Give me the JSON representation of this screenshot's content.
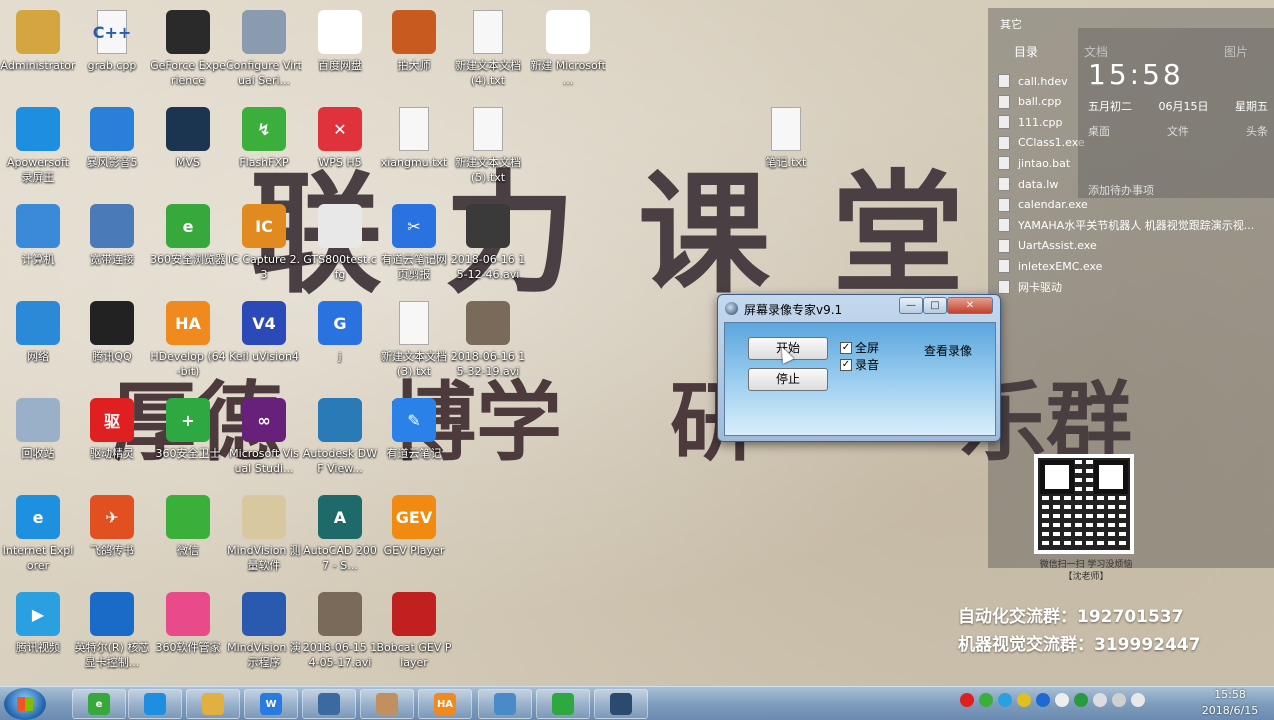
{
  "wallpaper": {
    "line1": "联力课堂",
    "line2": [
      "厚德",
      "博学",
      "研",
      "乐群"
    ],
    "contact1": "自动化交流群：192701537",
    "contact2": "机器视觉交流群：319992447",
    "qr_caption": "微信扫一扫 学习没烦恼\n【沈老师】"
  },
  "desktop_icons": [
    {
      "label": "Administrator",
      "color": "#d4a640",
      "icon": "user-folder-icon",
      "glyph": ""
    },
    {
      "label": "grab.cpp",
      "color": "#f4f4f4",
      "icon": "cpp-file-icon",
      "glyph": "C++"
    },
    {
      "label": "GeForce Experience",
      "color": "#2a2a2a",
      "icon": "nvidia-icon",
      "glyph": ""
    },
    {
      "label": "Configure Virtual Seri...",
      "color": "#8a9bb0",
      "icon": "serial-port-icon",
      "glyph": ""
    },
    {
      "label": "百度网盘",
      "color": "#ffffff",
      "icon": "baidu-netdisk-icon",
      "glyph": ""
    },
    {
      "label": "拍大师",
      "color": "#c85a20",
      "icon": "paidashi-icon",
      "glyph": ""
    },
    {
      "label": "新建文本文档 (4).txt",
      "color": "#f4f4f4",
      "icon": "text-file-icon",
      "glyph": ""
    },
    {
      "label": "新建 Microsoft ...",
      "color": "#ffffff",
      "icon": "excel-file-icon",
      "glyph": "X"
    },
    {
      "label": "Apowersoft 录屏王",
      "color": "#1e8fe0",
      "icon": "apowersoft-icon",
      "glyph": ""
    },
    {
      "label": "暴风影音5",
      "color": "#2a7fd8",
      "icon": "baofeng-icon",
      "glyph": ""
    },
    {
      "label": "MVS",
      "color": "#1b3550",
      "icon": "mvs-icon",
      "glyph": ""
    },
    {
      "label": "FlashFXP",
      "color": "#3cae3c",
      "icon": "flashfxp-icon",
      "glyph": "↯"
    },
    {
      "label": "WPS H5",
      "color": "#e0323a",
      "icon": "wps-h5-icon",
      "glyph": "✕"
    },
    {
      "label": "xiangmu.txt",
      "color": "#f4f4f4",
      "icon": "text-file-icon",
      "glyph": ""
    },
    {
      "label": "新建文本文档 (5).txt",
      "color": "#f4f4f4",
      "icon": "text-file-icon",
      "glyph": ""
    },
    {
      "label": "笔记.txt",
      "color": "#f4f4f4",
      "icon": "text-file-icon",
      "glyph": ""
    },
    {
      "label": "计算机",
      "color": "#3a8ad8",
      "icon": "computer-icon",
      "glyph": ""
    },
    {
      "label": "宽带连接",
      "color": "#4a7ab8",
      "icon": "broadband-icon",
      "glyph": ""
    },
    {
      "label": "360安全浏览器",
      "color": "#36a83c",
      "icon": "360-browser-icon",
      "glyph": "e"
    },
    {
      "label": "IC Capture 2.3",
      "color": "#e08a20",
      "icon": "ic-capture-icon",
      "glyph": "IC"
    },
    {
      "label": "GTS800test.cfg",
      "color": "#e8e8e8",
      "icon": "cfg-file-icon",
      "glyph": ""
    },
    {
      "label": "有道云笔记网页剪报",
      "color": "#2a72e0",
      "icon": "youdao-clip-icon",
      "glyph": "✂"
    },
    {
      "label": "2018-06-16 15-12-46.avi",
      "color": "#3a3a3a",
      "icon": "video-file-icon",
      "glyph": ""
    },
    {
      "label": "网络",
      "color": "#2a8ad8",
      "icon": "network-icon",
      "glyph": ""
    },
    {
      "label": "腾讯QQ",
      "color": "#222222",
      "icon": "qq-icon",
      "glyph": ""
    },
    {
      "label": "HDevelop (64-bit)",
      "color": "#f08a1e",
      "icon": "hdevelop-icon",
      "glyph": "HA"
    },
    {
      "label": "Keil uVision4",
      "color": "#2a4ab8",
      "icon": "keil-icon",
      "glyph": "V4"
    },
    {
      "label": "j",
      "color": "#2a72e0",
      "icon": "j-app-icon",
      "glyph": "G"
    },
    {
      "label": "新建文本文档 (3).txt",
      "color": "#f4f4f4",
      "icon": "text-file-icon",
      "glyph": ""
    },
    {
      "label": "2018-06-16 15-32-19.avi",
      "color": "#7a6a5a",
      "icon": "video-file-icon",
      "glyph": ""
    },
    {
      "label": "回收站",
      "color": "#9ab0c8",
      "icon": "recycle-bin-icon",
      "glyph": ""
    },
    {
      "label": "驱动精灵",
      "color": "#e02020",
      "icon": "driver-genius-icon",
      "glyph": "驱"
    },
    {
      "label": "360安全卫士",
      "color": "#2ea840",
      "icon": "360-safe-icon",
      "glyph": "+"
    },
    {
      "label": "Microsoft Visual Studi...",
      "color": "#68217a",
      "icon": "visual-studio-icon",
      "glyph": "∞"
    },
    {
      "label": "Autodesk DWF View...",
      "color": "#2a7ab8",
      "icon": "dwf-viewer-icon",
      "glyph": ""
    },
    {
      "label": "有道云笔记",
      "color": "#2a82e8",
      "icon": "youdao-note-icon",
      "glyph": "✎"
    },
    {
      "label": "Internet Explorer",
      "color": "#1e90e0",
      "icon": "ie-icon",
      "glyph": "e"
    },
    {
      "label": "飞鸽传书",
      "color": "#e05020",
      "icon": "feige-icon",
      "glyph": "✈"
    },
    {
      "label": "微信",
      "color": "#3ab03a",
      "icon": "wechat-icon",
      "glyph": ""
    },
    {
      "label": "MindVision 测量软件",
      "color": "#d8c8a0",
      "icon": "mindvision-measure-icon",
      "glyph": ""
    },
    {
      "label": "AutoCAD 2007 - S...",
      "color": "#1e6a6a",
      "icon": "autocad-icon",
      "glyph": "A"
    },
    {
      "label": "GEV Player",
      "color": "#f08a10",
      "icon": "gev-player-icon",
      "glyph": "GEV"
    },
    {
      "label": "腾讯视频",
      "color": "#2aa0e0",
      "icon": "tencent-video-icon",
      "glyph": "▶"
    },
    {
      "label": "英特尔(R) 核芯显卡控制...",
      "color": "#1a6ac8",
      "icon": "intel-graphics-icon",
      "glyph": ""
    },
    {
      "label": "360软件管家",
      "color": "#e84a8a",
      "icon": "360-software-icon",
      "glyph": ""
    },
    {
      "label": "MindVision 演示程序",
      "color": "#2a5ab0",
      "icon": "mindvision-demo-icon",
      "glyph": ""
    },
    {
      "label": "2018-06-15 14-05-17.avi",
      "color": "#7a6a5a",
      "icon": "video-file-icon",
      "glyph": ""
    },
    {
      "label": "Bobcat GEV Player",
      "color": "#c02020",
      "icon": "bobcat-icon",
      "glyph": ""
    }
  ],
  "sidebar": {
    "header": "其它",
    "tabs": [
      "目录",
      "文档",
      "图片"
    ],
    "files": [
      "call.hdev",
      "ball.cpp",
      "111.cpp",
      "CClass1.exe",
      "jintao.bat",
      "data.lw",
      "calendar.exe",
      "YAMAHA水平关节机器人 机器视觉跟踪演示视...",
      "UartAssist.exe",
      "inletexEMC.exe",
      "网卡驱动"
    ],
    "clock": {
      "time": "15:58",
      "lunar": "五月初二",
      "date": "06月15日",
      "weekday": "星期五",
      "actions": [
        "桌面",
        "文件",
        "头条"
      ],
      "todo": "添加待办事项"
    }
  },
  "dialog": {
    "title": "屏幕录像专家v9.1",
    "start_label": "开始",
    "stop_label": "停止",
    "fullscreen_label": "全屏",
    "record_audio_label": "录音",
    "fullscreen_checked": "✓",
    "audio_checked": "✓",
    "view_label": "查看录像",
    "min_glyph": "—",
    "max_glyph": "□",
    "close_glyph": "✕"
  },
  "taskbar": {
    "items": [
      {
        "icon": "360-browser-icon",
        "color": "#36a83c",
        "glyph": "e"
      },
      {
        "icon": "apowersoft-icon",
        "color": "#1e8fe0",
        "glyph": ""
      },
      {
        "icon": "explorer-folder-icon",
        "color": "#e0b040",
        "glyph": ""
      },
      {
        "icon": "wps-writer-icon",
        "color": "#2a7ae0",
        "glyph": "W"
      },
      {
        "icon": "screen-icon",
        "color": "#3a6aa0",
        "glyph": ""
      },
      {
        "icon": "paint-icon",
        "color": "#c09060",
        "glyph": ""
      },
      {
        "icon": "hdevelop-icon",
        "color": "#f08a1e",
        "glyph": "HA"
      },
      {
        "icon": "remote-icon",
        "color": "#4a8ac8",
        "glyph": ""
      },
      {
        "icon": "inletex-icon",
        "color": "#2ea840",
        "glyph": ""
      },
      {
        "icon": "screen-recorder-icon",
        "color": "#2a4a70",
        "glyph": ""
      }
    ],
    "time": "15:58",
    "date": "2018/6/15"
  }
}
